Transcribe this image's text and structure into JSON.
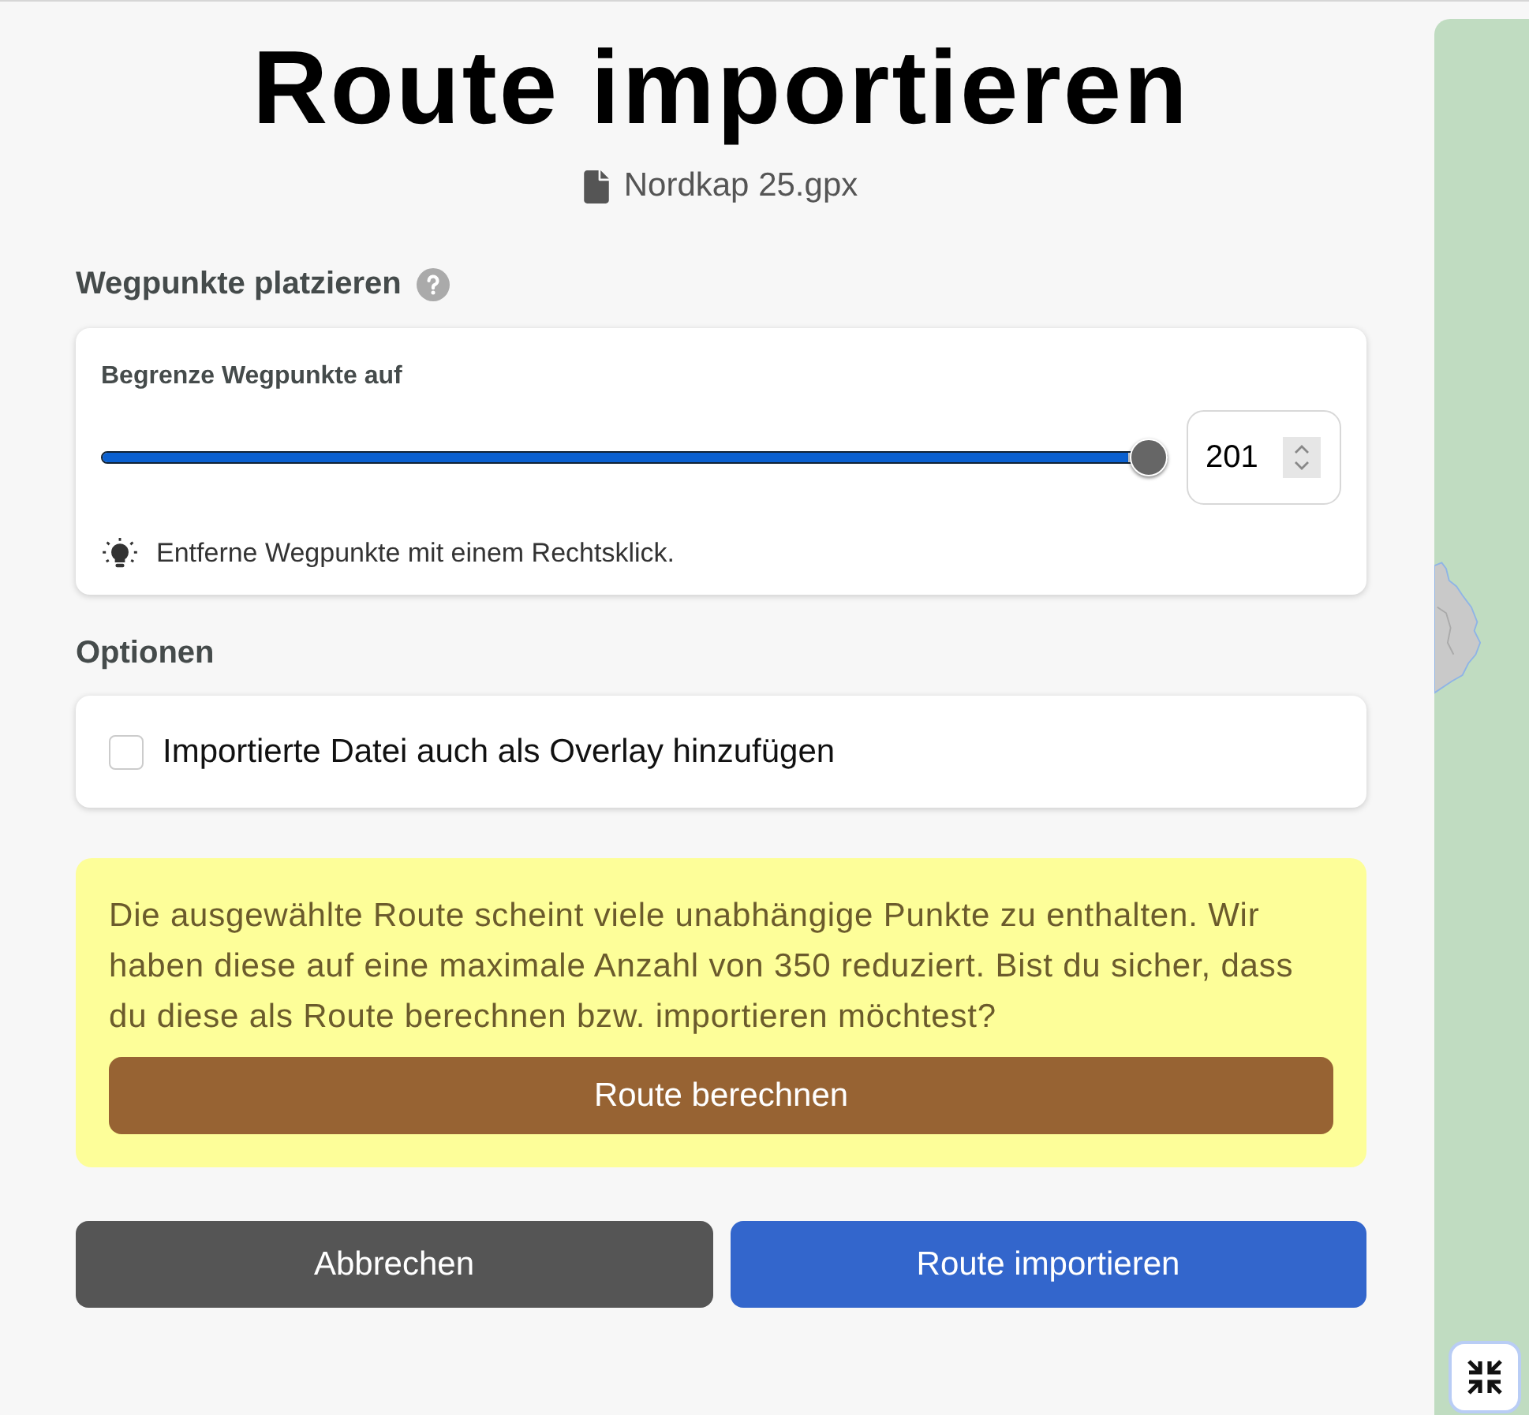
{
  "title": "Route importieren",
  "file": {
    "name": "Nordkap 25.gpx"
  },
  "waypoints": {
    "heading": "Wegpunkte platzieren",
    "limit_label": "Begrenze Wegpunkte auf",
    "slider": {
      "level": 1
    },
    "limit_value": "201",
    "tip": "Entferne Wegpunkte mit einem Rechtsklick."
  },
  "options": {
    "heading": "Optionen",
    "items": [
      {
        "label": "Importierte Datei auch als Overlay hinzufügen",
        "checked": false
      }
    ]
  },
  "warning": {
    "text": "Die ausgewählte Route scheint viele unabhängige Punkte zu enthalten. Wir haben diese auf eine maximale Anzahl von 350 reduziert. Bist du sicher, dass du diese als Route berechnen bzw. importieren möchtest?",
    "button": "Route berechnen"
  },
  "buttons": [
    {
      "label": "Abbrechen",
      "kind": "secondary"
    },
    {
      "label": "Route importieren",
      "kind": "primary"
    }
  ]
}
